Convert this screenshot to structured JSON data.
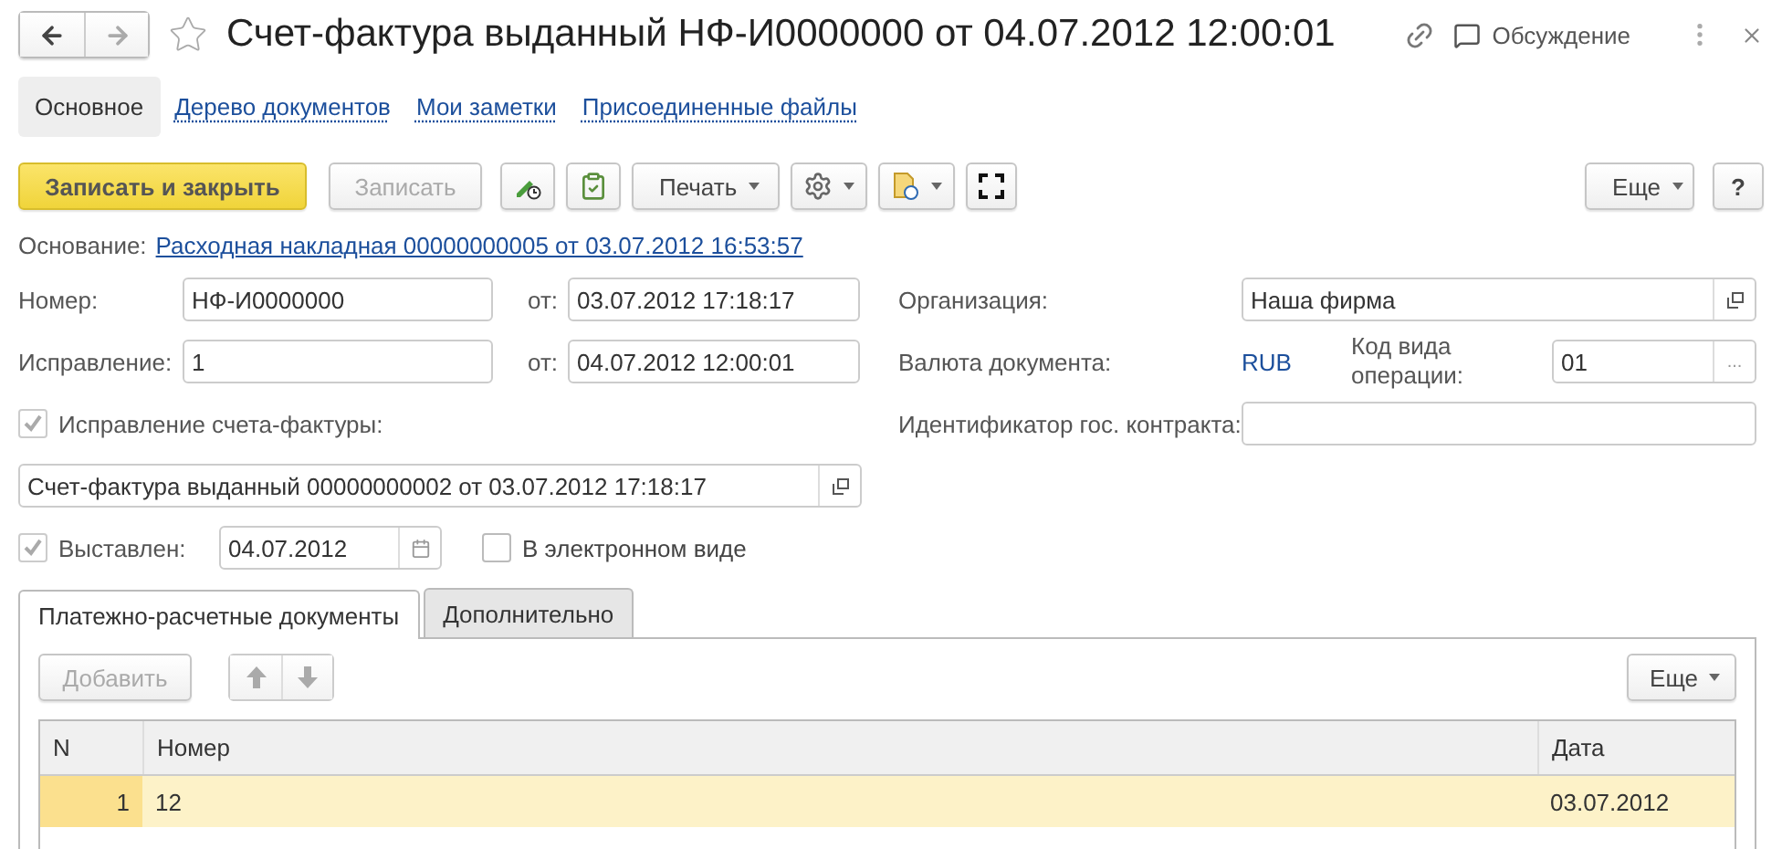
{
  "window": {
    "title": "Счет-фактура выданный НФ-И0000000 от 04.07.2012 12:00:01",
    "favorite": false,
    "forward_disabled": true,
    "discussion": "Обсуждение"
  },
  "sections": [
    {
      "label": "Основное",
      "selected": true
    },
    {
      "label": "Дерево документов",
      "selected": false
    },
    {
      "label": "Мои заметки",
      "selected": false
    },
    {
      "label": "Присоединенные файлы",
      "selected": false
    }
  ],
  "toolbar": {
    "save_close": "Записать и закрыть",
    "save": {
      "label": "Записать",
      "disabled": true
    },
    "print": "Печать",
    "more": "Еще",
    "help": "?"
  },
  "basis": {
    "label": "Основание:",
    "link": "Расходная накладная 00000000005 от 03.07.2012 16:53:57"
  },
  "number": {
    "label": "Номер:",
    "value": "НФ-И0000000",
    "date_label": "от:",
    "date": "03.07.2012 17:18:17"
  },
  "correction": {
    "label": "Исправление:",
    "value": "1",
    "date_label": "от:",
    "date": "04.07.2012 12:00:01"
  },
  "correction_flag": {
    "label": "Исправление счета-фактуры:",
    "checked": true,
    "disabled": true
  },
  "corrected_invoice": {
    "value": "Счет-фактура выданный 00000000002 от 03.07.2012 17:18:17"
  },
  "issued": {
    "label": "Выставлен:",
    "checked": true,
    "disabled": true,
    "date": "04.07.2012"
  },
  "electronic": {
    "label": "В электронном виде",
    "checked": false,
    "disabled": false
  },
  "organization": {
    "label": "Организация:",
    "value": "Наша фирма"
  },
  "currency": {
    "label": "Валюта документа:",
    "value": "RUB"
  },
  "operation_code": {
    "label": "Код вида операции:",
    "value": "01",
    "button": "..."
  },
  "contract": {
    "label": "Идентификатор гос. контракта:"
  },
  "tabs": [
    {
      "label": "Платежно-расчетные документы",
      "selected": true
    },
    {
      "label": "Дополнительно",
      "selected": false
    }
  ],
  "table_toolbar": {
    "add": {
      "label": "Добавить",
      "disabled": true
    },
    "more": "Еще"
  },
  "table": {
    "columns": [
      "N",
      "Номер",
      "Дата"
    ],
    "rows": [
      {
        "cells": [
          "1",
          "12",
          "03.07.2012"
        ],
        "selected": true
      }
    ]
  }
}
